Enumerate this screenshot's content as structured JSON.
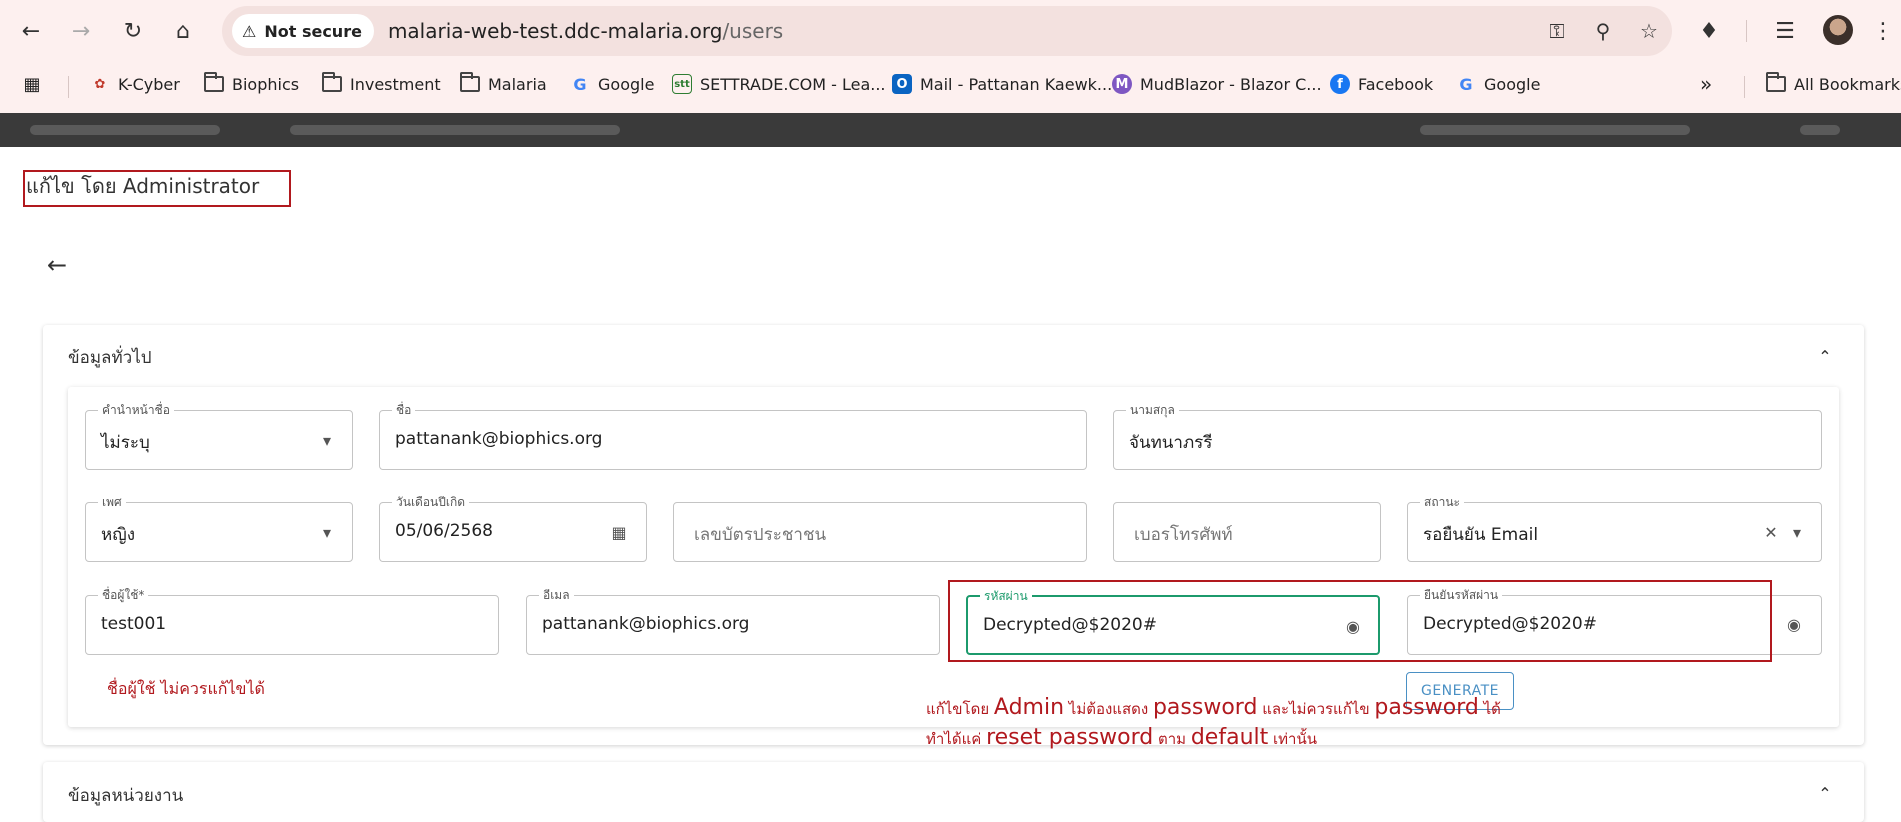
{
  "browser": {
    "security_label": "Not secure",
    "url_host": "malaria-web-test.ddc-malaria.org",
    "url_path": "/users",
    "bookmarks": [
      {
        "label": "K-Cyber",
        "icon": "k-cyber-icon"
      },
      {
        "label": "Biophics",
        "icon": "folder-icon"
      },
      {
        "label": "Investment",
        "icon": "folder-icon"
      },
      {
        "label": "Malaria",
        "icon": "folder-icon"
      },
      {
        "label": "Google",
        "icon": "google-icon"
      },
      {
        "label": "SETTRADE.COM - Lea...",
        "icon": "settrade-icon"
      },
      {
        "label": "Mail - Pattanan Kaewk...",
        "icon": "outlook-icon"
      },
      {
        "label": "MudBlazor - Blazor C...",
        "icon": "mudblazor-icon"
      },
      {
        "label": "Facebook",
        "icon": "facebook-icon"
      },
      {
        "label": "Google",
        "icon": "google-icon"
      }
    ],
    "all_bookmarks_label": "All Bookmarks"
  },
  "page": {
    "title": "แก้ไข โดย Administrator"
  },
  "general_section": {
    "title": "ข้อมูลทั่วไป",
    "fields": {
      "prefix": {
        "label": "คำนำหน้าชื่อ",
        "value": "ไม่ระบุ"
      },
      "first_name": {
        "label": "ชื่อ",
        "value": "pattanank@biophics.org"
      },
      "last_name": {
        "label": "นามสกุล",
        "value": "จันทนาภรรี"
      },
      "gender": {
        "label": "เพศ",
        "value": "หญิง"
      },
      "birth_date": {
        "label": "วันเดือนปีเกิด",
        "value": "05/06/2568"
      },
      "national_id": {
        "placeholder": "เลขบัตรประชาชน"
      },
      "phone": {
        "placeholder": "เบอรโทรศัพท์"
      },
      "status": {
        "label": "สถานะ",
        "value": "รอยืนยัน Email"
      },
      "username": {
        "label": "ชื่อผู้ใช้*",
        "value": "test001"
      },
      "email": {
        "label": "อีเมล",
        "value": "pattanank@biophics.org"
      },
      "password": {
        "label": "รหัสผ่าน",
        "value": "Decrypted@$2020#"
      },
      "confirm_password": {
        "label": "ยืนยันรหัสผ่าน",
        "value": "Decrypted@$2020#"
      }
    },
    "generate_label": "GENERATE",
    "note_username": "ชื่อผู้ใช้ ไม่ควรแก้ไขได้",
    "note_line1": {
      "p1": "แก้ไขโดย ",
      "p2": "Admin",
      "p3": " ไม่ต้องแสดง ",
      "p4": "password",
      "p5": " และไม่ควรแก้ไข ",
      "p6": "password",
      "p7": " ได้"
    },
    "note_line2": {
      "p1": "ทำได้แค่ ",
      "p2": "reset password",
      "p3": " ตาม ",
      "p4": "default",
      "p5": "  เท่านั้น"
    }
  },
  "unit_section": {
    "title": "ข้อมูลหน่วยงาน"
  },
  "colors": {
    "annotation_red": "#b1191e",
    "focus_green": "#1c9a6c",
    "button_blue": "#4a90c4"
  }
}
